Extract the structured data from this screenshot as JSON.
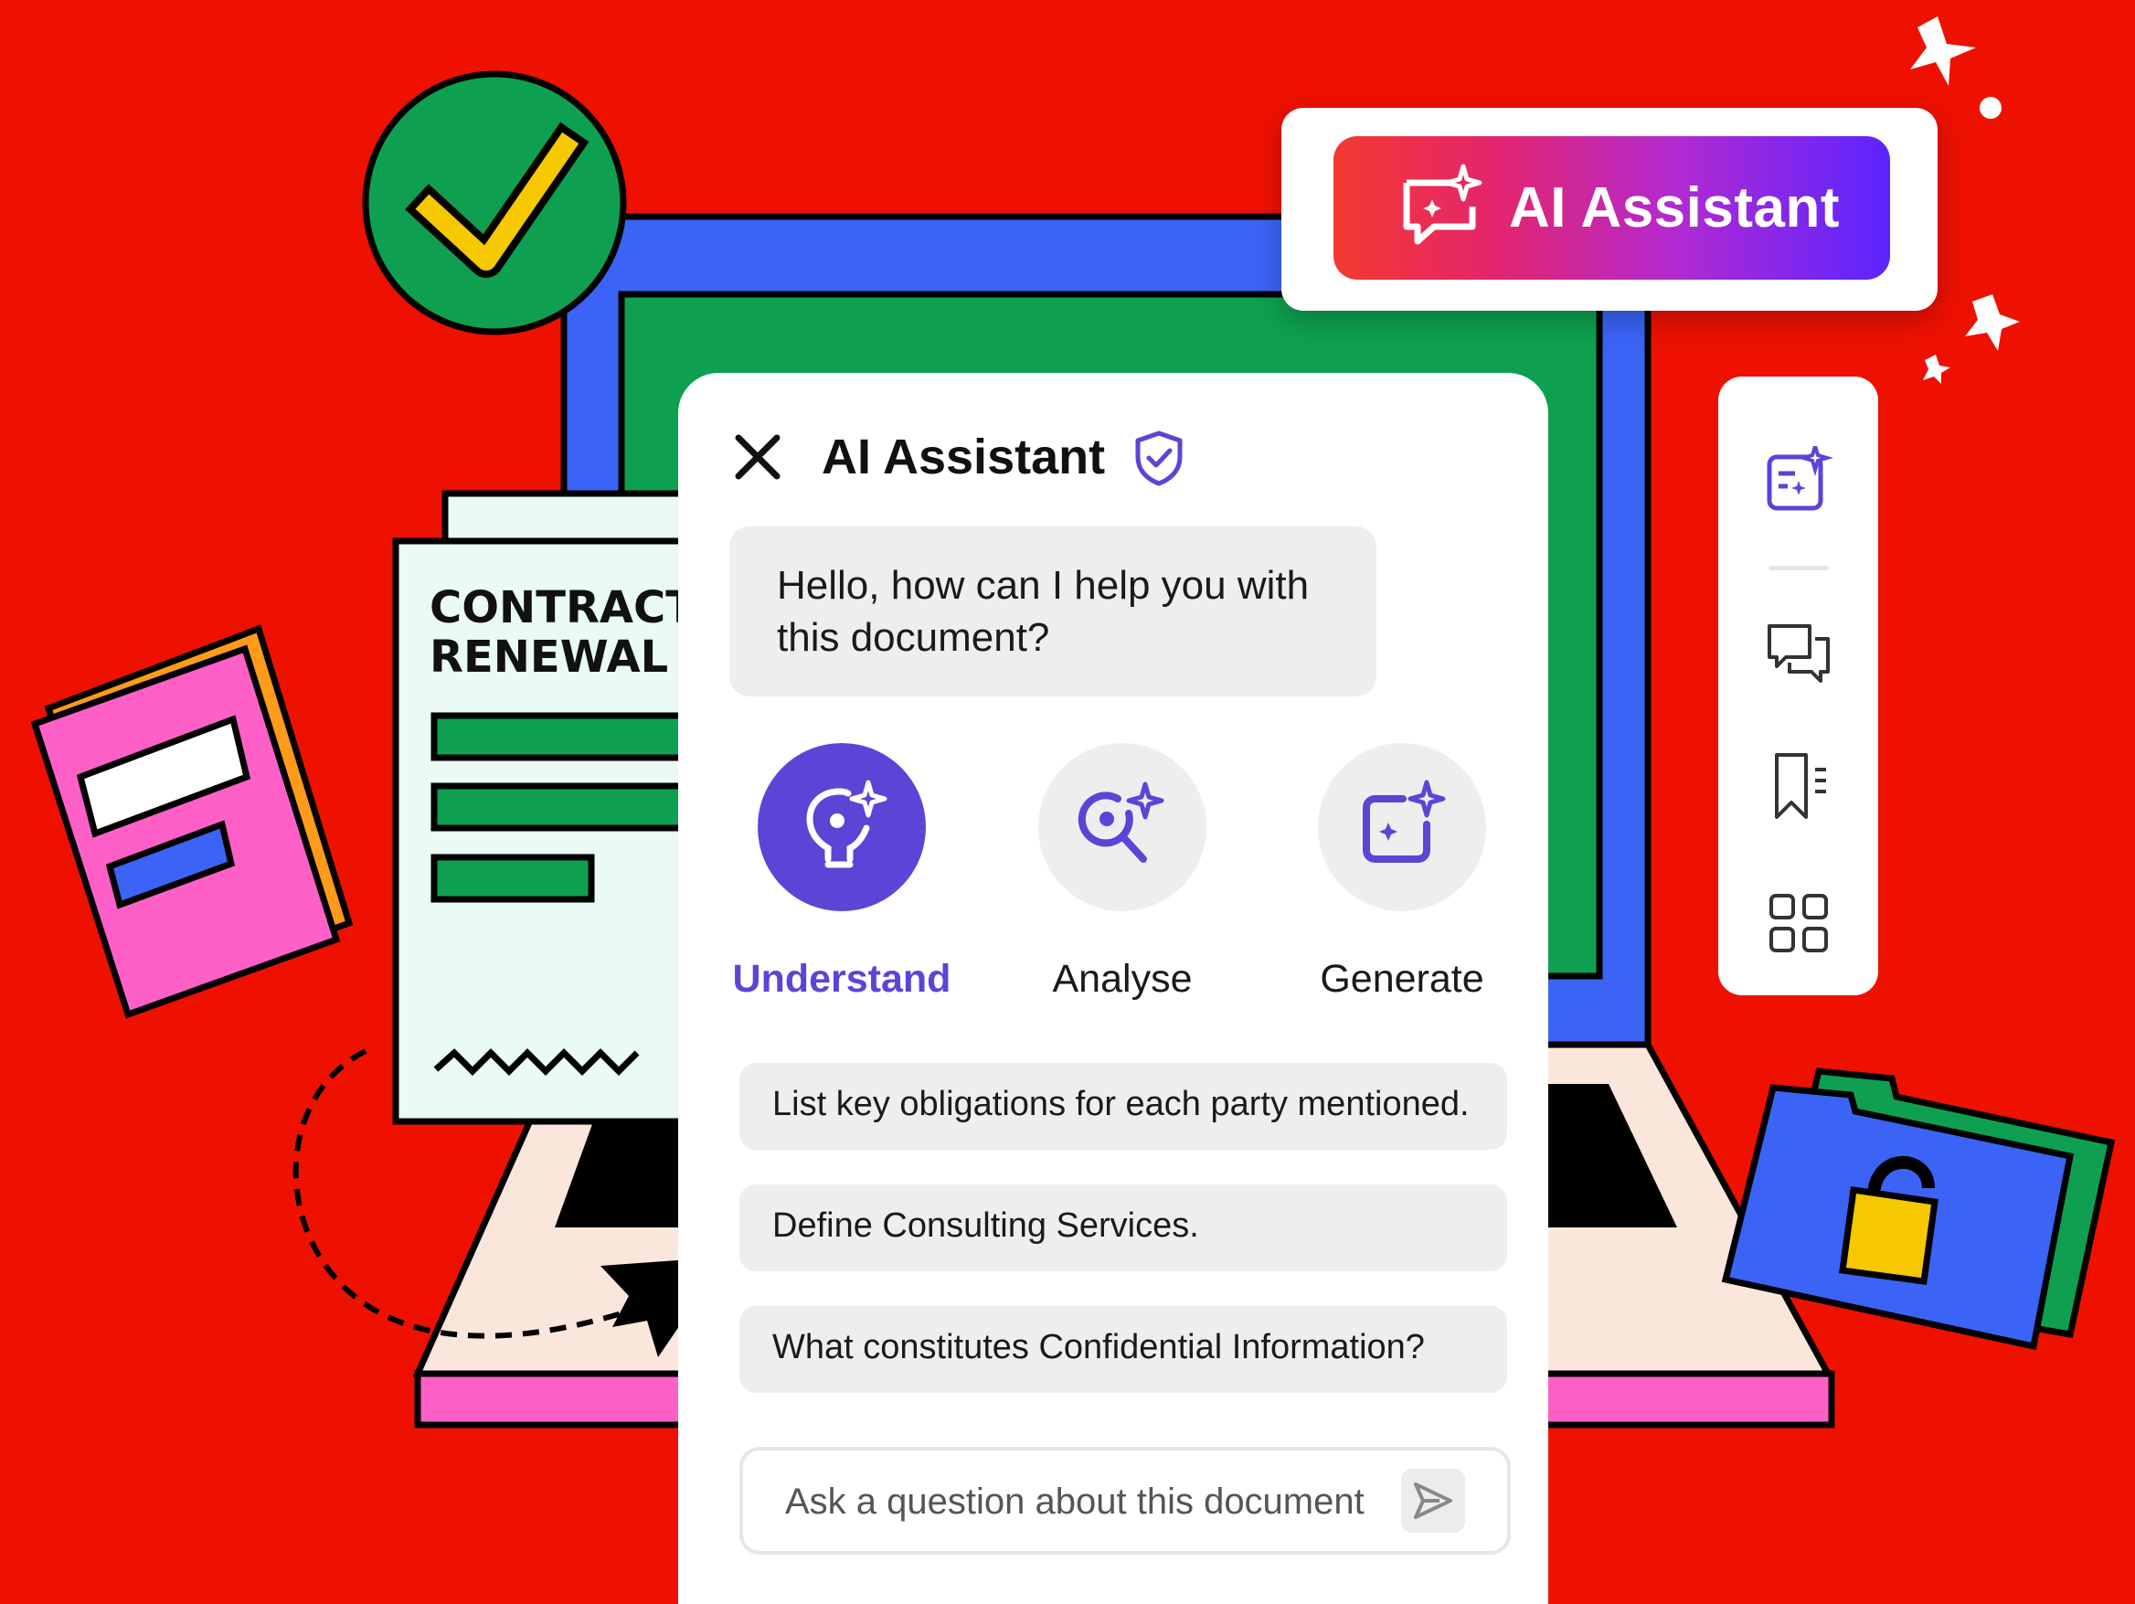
{
  "colors": {
    "background": "#ee1100",
    "accent": "#5a45d6",
    "monitor_frame": "#3b63f5",
    "screen": "#0ea050",
    "pink": "#ff60c8",
    "yellow": "#f5c800"
  },
  "badge": {
    "label": "AI Assistant",
    "icon": "ai-chat-sparkle-icon"
  },
  "contract": {
    "line1": "CONTRACT",
    "line2": "RENEWAL"
  },
  "panel": {
    "title": "AI Assistant",
    "close_icon": "close-icon",
    "shield_icon": "shield-check-icon",
    "greeting": "Hello, how can I help you with this document?",
    "modes": [
      {
        "label": "Understand",
        "icon": "lightbulb-sparkle-icon",
        "active": true
      },
      {
        "label": "Analyse",
        "icon": "search-sparkle-icon",
        "active": false
      },
      {
        "label": "Generate",
        "icon": "generate-sparkle-icon",
        "active": false
      }
    ],
    "suggestions": [
      "List key obligations for each party mentioned.",
      "Define Consulting Services.",
      "What constitutes Confidential Information?"
    ],
    "input": {
      "placeholder": "Ask a question about this document",
      "value": ""
    }
  },
  "toolbar": {
    "items": [
      {
        "icon": "edit-sparkle-icon"
      },
      {
        "icon": "comments-icon"
      },
      {
        "icon": "bookmark-list-icon"
      },
      {
        "icon": "grid-icon"
      }
    ]
  }
}
